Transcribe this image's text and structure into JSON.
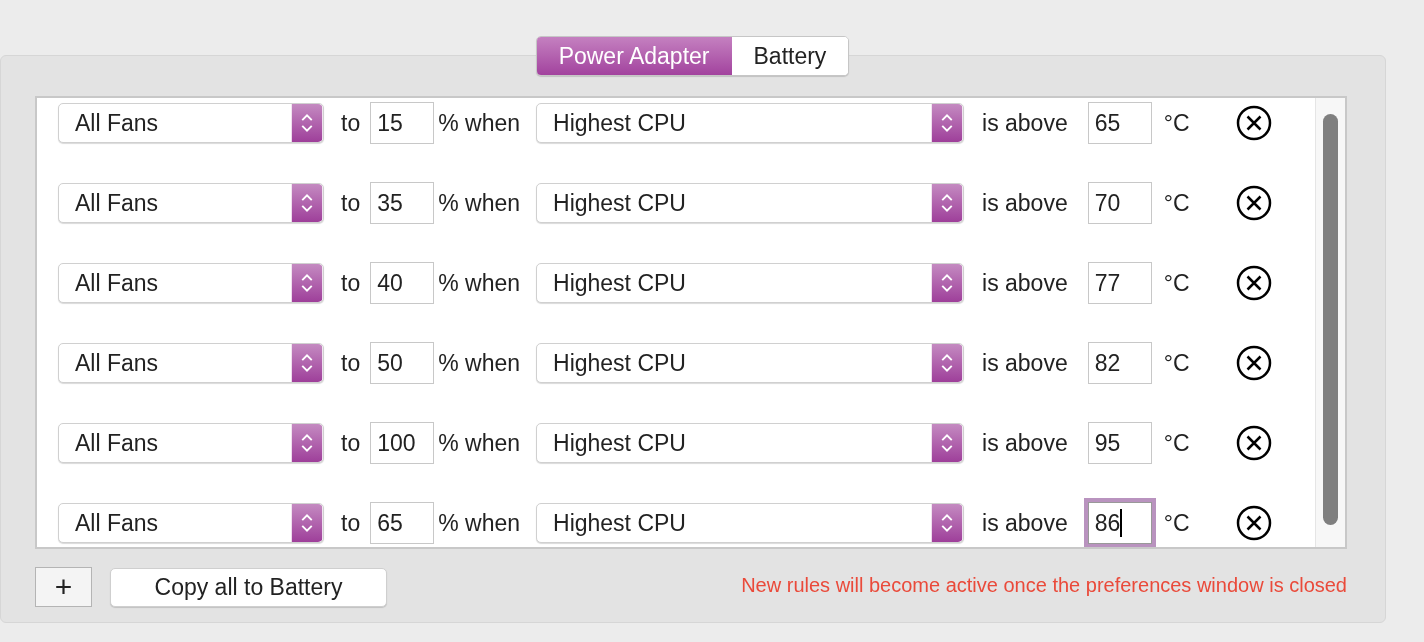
{
  "tabs": [
    {
      "label": "Power Adapter",
      "selected": true
    },
    {
      "label": "Battery",
      "selected": false
    }
  ],
  "rules": [
    {
      "fan": "All Fans",
      "to_label": "to",
      "percent": "15",
      "when_label": "% when",
      "sensor": "Highest CPU",
      "above_label": "is above",
      "temperature": {
        "value": "65",
        "focused": false
      },
      "unit": "°C"
    },
    {
      "fan": "All Fans",
      "to_label": "to",
      "percent": "35",
      "when_label": "% when",
      "sensor": "Highest CPU",
      "above_label": "is above",
      "temperature": {
        "value": "70",
        "focused": false
      },
      "unit": "°C"
    },
    {
      "fan": "All Fans",
      "to_label": "to",
      "percent": "40",
      "when_label": "% when",
      "sensor": "Highest CPU",
      "above_label": "is above",
      "temperature": {
        "value": "77",
        "focused": false
      },
      "unit": "°C"
    },
    {
      "fan": "All Fans",
      "to_label": "to",
      "percent": "50",
      "when_label": "% when",
      "sensor": "Highest CPU",
      "above_label": "is above",
      "temperature": {
        "value": "82",
        "focused": false
      },
      "unit": "°C"
    },
    {
      "fan": "All Fans",
      "to_label": "to",
      "percent": "100",
      "when_label": "% when",
      "sensor": "Highest CPU",
      "above_label": "is above",
      "temperature": {
        "value": "95",
        "focused": false
      },
      "unit": "°C"
    },
    {
      "fan": "All Fans",
      "to_label": "to",
      "percent": "65",
      "when_label": "% when",
      "sensor": "Highest CPU",
      "above_label": "is above",
      "temperature": {
        "value": "86",
        "focused": true
      },
      "unit": "°C"
    }
  ],
  "add_button": "+",
  "copy_button": "Copy all to Battery",
  "notice": "New rules will become active once the preferences window is closed"
}
